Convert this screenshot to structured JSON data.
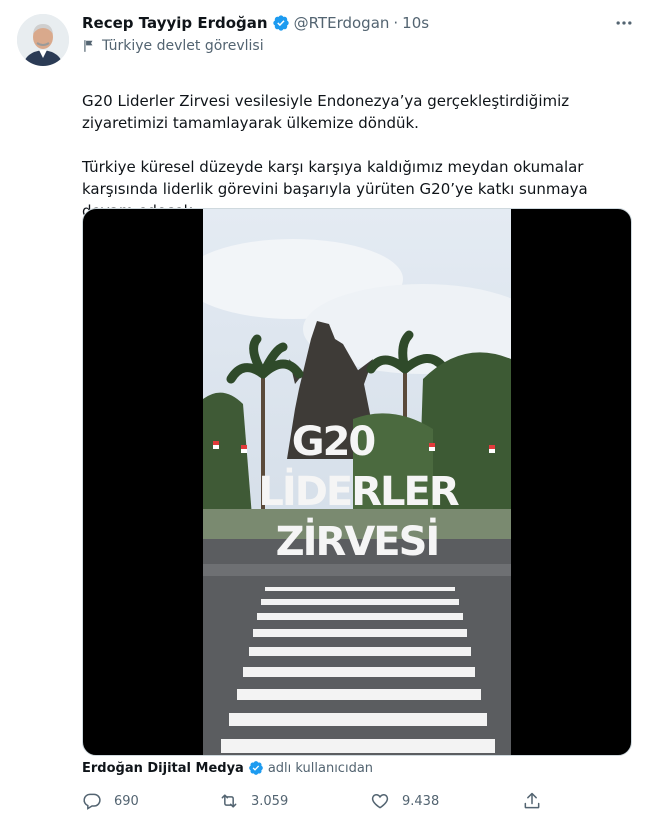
{
  "author": {
    "display_name": "Recep Tayyip Erdoğan",
    "handle": "@RTErdogan",
    "separator": "·",
    "time": "10s",
    "verified_icon": "verified-badge-icon",
    "label": "Türkiye devlet görevlisi",
    "label_icon": "flag-icon"
  },
  "tweet": {
    "paragraph_1": "G20 Liderler Zirvesi vesilesiyle Endonezya’ya gerçekleştirdiğimiz ziyaretimizi tamamlayarak ülkemize döndük.",
    "paragraph_2": "Türkiye küresel düzeyde karşı karşıya kaldığımız meydan okumalar karşısında liderlik görevini başarıyla yürüten G20’ye katkı sunmaya devam edecek.",
    "emoji": "turkey-flag-icon"
  },
  "media": {
    "overlay_line_1": "G20",
    "overlay_line_2": "LİDERLER",
    "overlay_line_3": "ZİRVESİ"
  },
  "source": {
    "name": "Erdoğan Dijital Medya",
    "suffix": "adlı kullanıcıdan",
    "verified_icon": "verified-badge-icon"
  },
  "actions": {
    "replies": "690",
    "retweets": "3.059",
    "likes": "9.438"
  },
  "colors": {
    "verified": "#1d9bf0",
    "text": "#0f1419",
    "secondary": "#536471",
    "flag_red": "#e30a17"
  }
}
